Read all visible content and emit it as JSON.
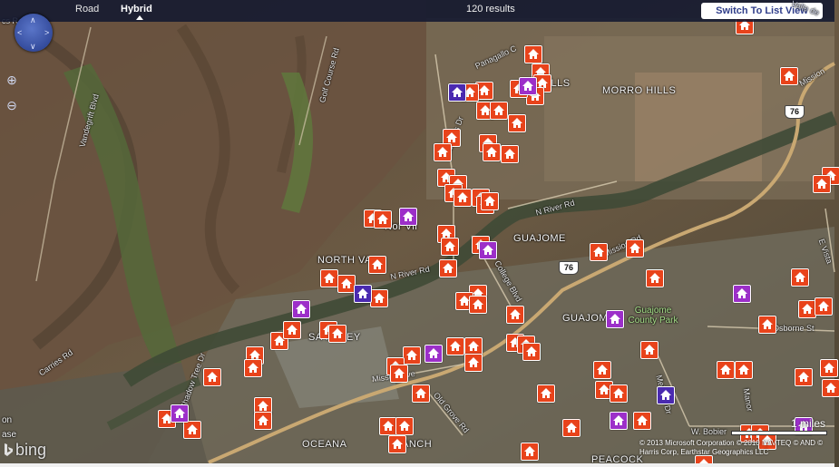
{
  "toolbar": {
    "road_label": "Road",
    "hybrid_label": "Hybrid",
    "results_text": "120 results",
    "switch_button_label": "Switch To List View",
    "corner_text": "Valle de"
  },
  "navigation": {
    "pan_icon": "compass-icon",
    "zoom_in_icon": "zoom-in-icon",
    "zoom_out_icon": "zoom-out-icon"
  },
  "map_labels": {
    "morro_hills": "MORRO HILLS",
    "north_village_a": "Nor  Vil",
    "north_village_b": "NORTH VA",
    "guajome": "GUAJOME",
    "guajome_2": "GUAJOME",
    "san_luis_rey": "SA   IS REY",
    "oceana": "OCEANA",
    "ranch": "VANCH",
    "peacock": "PEACOCK",
    "guajome_park": "Guajome County Park",
    "los_lomas": "on",
    "base": "ase",
    "hills_suffix": "ILLS",
    "partial_left": "cs Rd"
  },
  "road_labels": {
    "vandegrift": "Vandegrift Blvd",
    "golf_course": "Golf Course Rd",
    "douglas": "Douglas Dr",
    "n_river_1": "N River Rd",
    "n_river_2": "N River Rd",
    "college": "College Blvd",
    "mission_1": "Mission Rd",
    "mission_2": "Mission",
    "mission_ave": "Mission Ave",
    "old_grove": "Old Grove Rd",
    "shadow_tree": "Shadow Tree Dr",
    "carries": "Carries Rd",
    "melrose": "Melrose Dr",
    "osborne": "Osborne St",
    "w_bobier": "W. Bobier",
    "e_vista": "E Vista",
    "pangallo": "Panagallo C",
    "manor": "Manor"
  },
  "shields": {
    "hwy76_a": "76",
    "hwy76_b": "76",
    "hwy76_c": "76"
  },
  "branding": {
    "logo_text": "bing"
  },
  "copyright_text": "© 2013 Microsoft Corporation  © 2010 NAVTEQ  © AND  © Harris Corp, Earthstar Geographics LLC",
  "scale_label": "1 miles",
  "listing_markers": {
    "red_count": 95,
    "purple_count": 10,
    "blue_count": 3
  },
  "colors": {
    "listing_red": "#e8431b",
    "listing_purple": "#9c2fc9",
    "listing_blue": "#4a2ab0",
    "toolbar_bg": "#121830",
    "button_text": "#2f3d8a"
  }
}
